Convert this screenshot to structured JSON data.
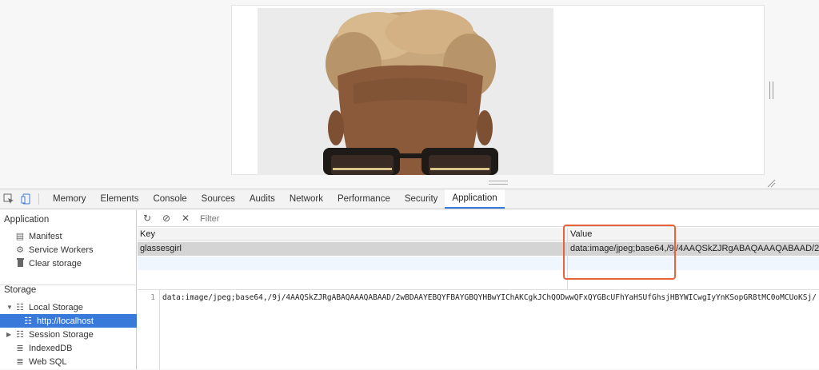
{
  "devtools": {
    "tabs": [
      "Memory",
      "Elements",
      "Console",
      "Sources",
      "Audits",
      "Network",
      "Performance",
      "Security",
      "Application"
    ],
    "active_tab": "Application"
  },
  "sidebar": {
    "application_title": "Application",
    "application_items": [
      {
        "label": "Manifest",
        "icon": "document-icon"
      },
      {
        "label": "Service Workers",
        "icon": "gear-icon"
      },
      {
        "label": "Clear storage",
        "icon": "trash-icon"
      }
    ],
    "storage_title": "Storage",
    "local_storage": "Local Storage",
    "local_storage_origin": "http://localhost",
    "session_storage": "Session Storage",
    "indexeddb": "IndexedDB",
    "websql": "Web SQL"
  },
  "toolbar": {
    "filter_placeholder": "Filter"
  },
  "table": {
    "columns": [
      "Key",
      "Value"
    ],
    "rows": [
      {
        "key": "glassesgirl",
        "value": "data:image/jpeg;base64,/9j/4AAQSkZJRgABAQAAAQABAAD/2wBDAAYEBQ"
      }
    ]
  },
  "preview": {
    "line_number": "1",
    "text": "data:image/jpeg;base64,/9j/4AAQSkZJRgABAQAAAQABAAD/2wBDAAYEBQYFBAYGBQYHBwYIChAKCgkJChQODwwQFxQYGBcUFhYaHSUfGhsjHBYWICwgIyYnKSopGR8tMC0oMCUoKSj/"
  },
  "colors": {
    "accent": "#3879d9",
    "highlight": "#e8623a"
  }
}
